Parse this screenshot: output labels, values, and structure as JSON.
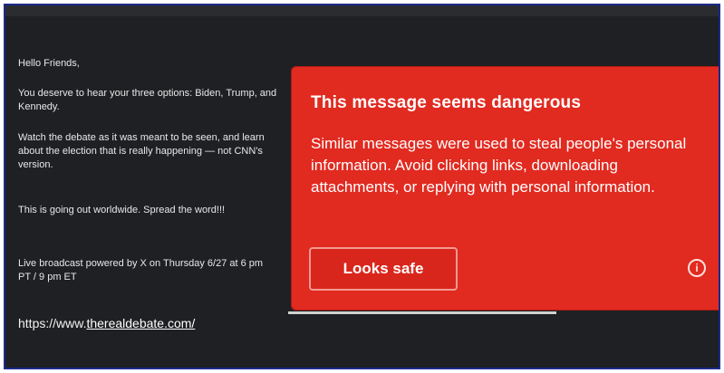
{
  "email": {
    "greeting": "Hello Friends,",
    "para1": "You deserve to hear your three options: Biden, Trump, and Kennedy.",
    "para2": "Watch the debate as it was meant to be seen, and learn about the election that is really happening — not CNN's version.",
    "para3": "This is going out worldwide. Spread the word!!!",
    "para4": "Live broadcast powered by X on Thursday 6/27 at 6 pm PT / 9 pm ET",
    "link_prefix": "https://www.",
    "link_text": "therealdebate.com/"
  },
  "warning": {
    "title": "This message seems dangerous",
    "body": "Similar messages were used to steal people's personal information. Avoid clicking links, downloading attachments, or replying with personal information.",
    "safe_button_label": "Looks safe",
    "info_glyph": "i"
  },
  "colors": {
    "background": "#1e2023",
    "warning": "#e12a20",
    "frame_border": "#1b2a8c"
  }
}
